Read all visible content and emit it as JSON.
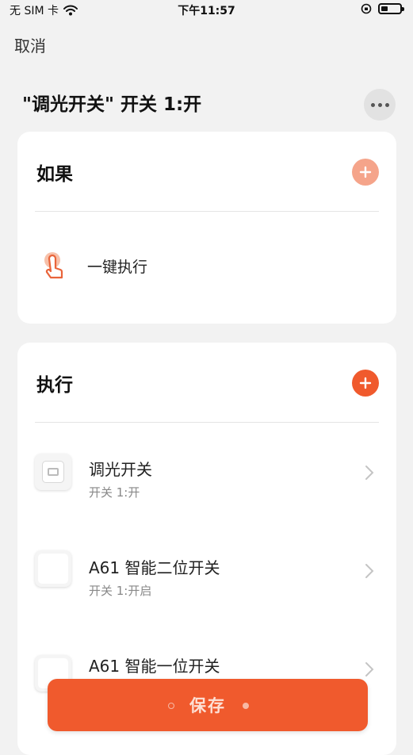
{
  "status_bar": {
    "carrier": "无 SIM 卡",
    "time": "下午11:57",
    "battery_level": 0.35
  },
  "nav": {
    "cancel_label": "取消"
  },
  "page": {
    "title": "\"调光开关\" 开关 1:开"
  },
  "if_section": {
    "title": "如果",
    "add_color": "#f5a48a",
    "trigger": {
      "label": "一键执行",
      "icon": "hand-tap-icon"
    }
  },
  "exec_section": {
    "title": "执行",
    "add_color": "#f05a2d",
    "devices": [
      {
        "name": "调光开关",
        "state": "开关 1:开",
        "icon": "dimmer-switch-icon"
      },
      {
        "name": "A61 智能二位开关",
        "state": "开关 1:开启",
        "icon": "wall-switch-icon"
      },
      {
        "name": "A61 智能一位开关",
        "state": "",
        "icon": "wall-switch-icon"
      }
    ]
  },
  "footer": {
    "save_label": "保存",
    "accent": "#f05a2d"
  }
}
